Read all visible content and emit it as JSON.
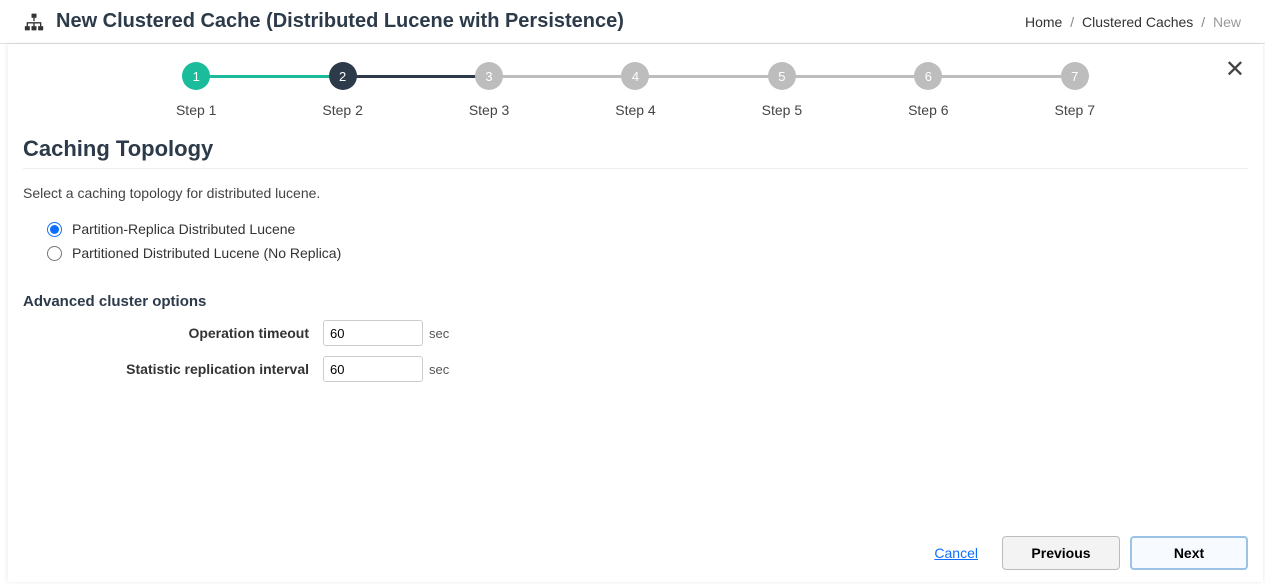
{
  "header": {
    "title": "New Clustered Cache (Distributed Lucene with Persistence)"
  },
  "breadcrumb": {
    "home": "Home",
    "caches": "Clustered Caches",
    "current": "New"
  },
  "stepper": {
    "steps": [
      {
        "num": "1",
        "label": "Step 1",
        "state": "completed"
      },
      {
        "num": "2",
        "label": "Step 2",
        "state": "active"
      },
      {
        "num": "3",
        "label": "Step 3",
        "state": "pending"
      },
      {
        "num": "4",
        "label": "Step 4",
        "state": "pending"
      },
      {
        "num": "5",
        "label": "Step 5",
        "state": "pending"
      },
      {
        "num": "6",
        "label": "Step 6",
        "state": "pending"
      },
      {
        "num": "7",
        "label": "Step 7",
        "state": "pending"
      }
    ]
  },
  "section": {
    "title": "Caching Topology",
    "description": "Select a caching topology for distributed lucene."
  },
  "topology": {
    "options": [
      {
        "label": "Partition-Replica Distributed Lucene",
        "selected": true
      },
      {
        "label": "Partitioned Distributed Lucene (No Replica)",
        "selected": false
      }
    ]
  },
  "advanced": {
    "heading": "Advanced cluster options",
    "fields": {
      "operation_timeout": {
        "label": "Operation timeout",
        "value": "60",
        "unit": "sec"
      },
      "stat_replication": {
        "label": "Statistic replication interval",
        "value": "60",
        "unit": "sec"
      }
    }
  },
  "footer": {
    "cancel": "Cancel",
    "previous": "Previous",
    "next": "Next"
  }
}
